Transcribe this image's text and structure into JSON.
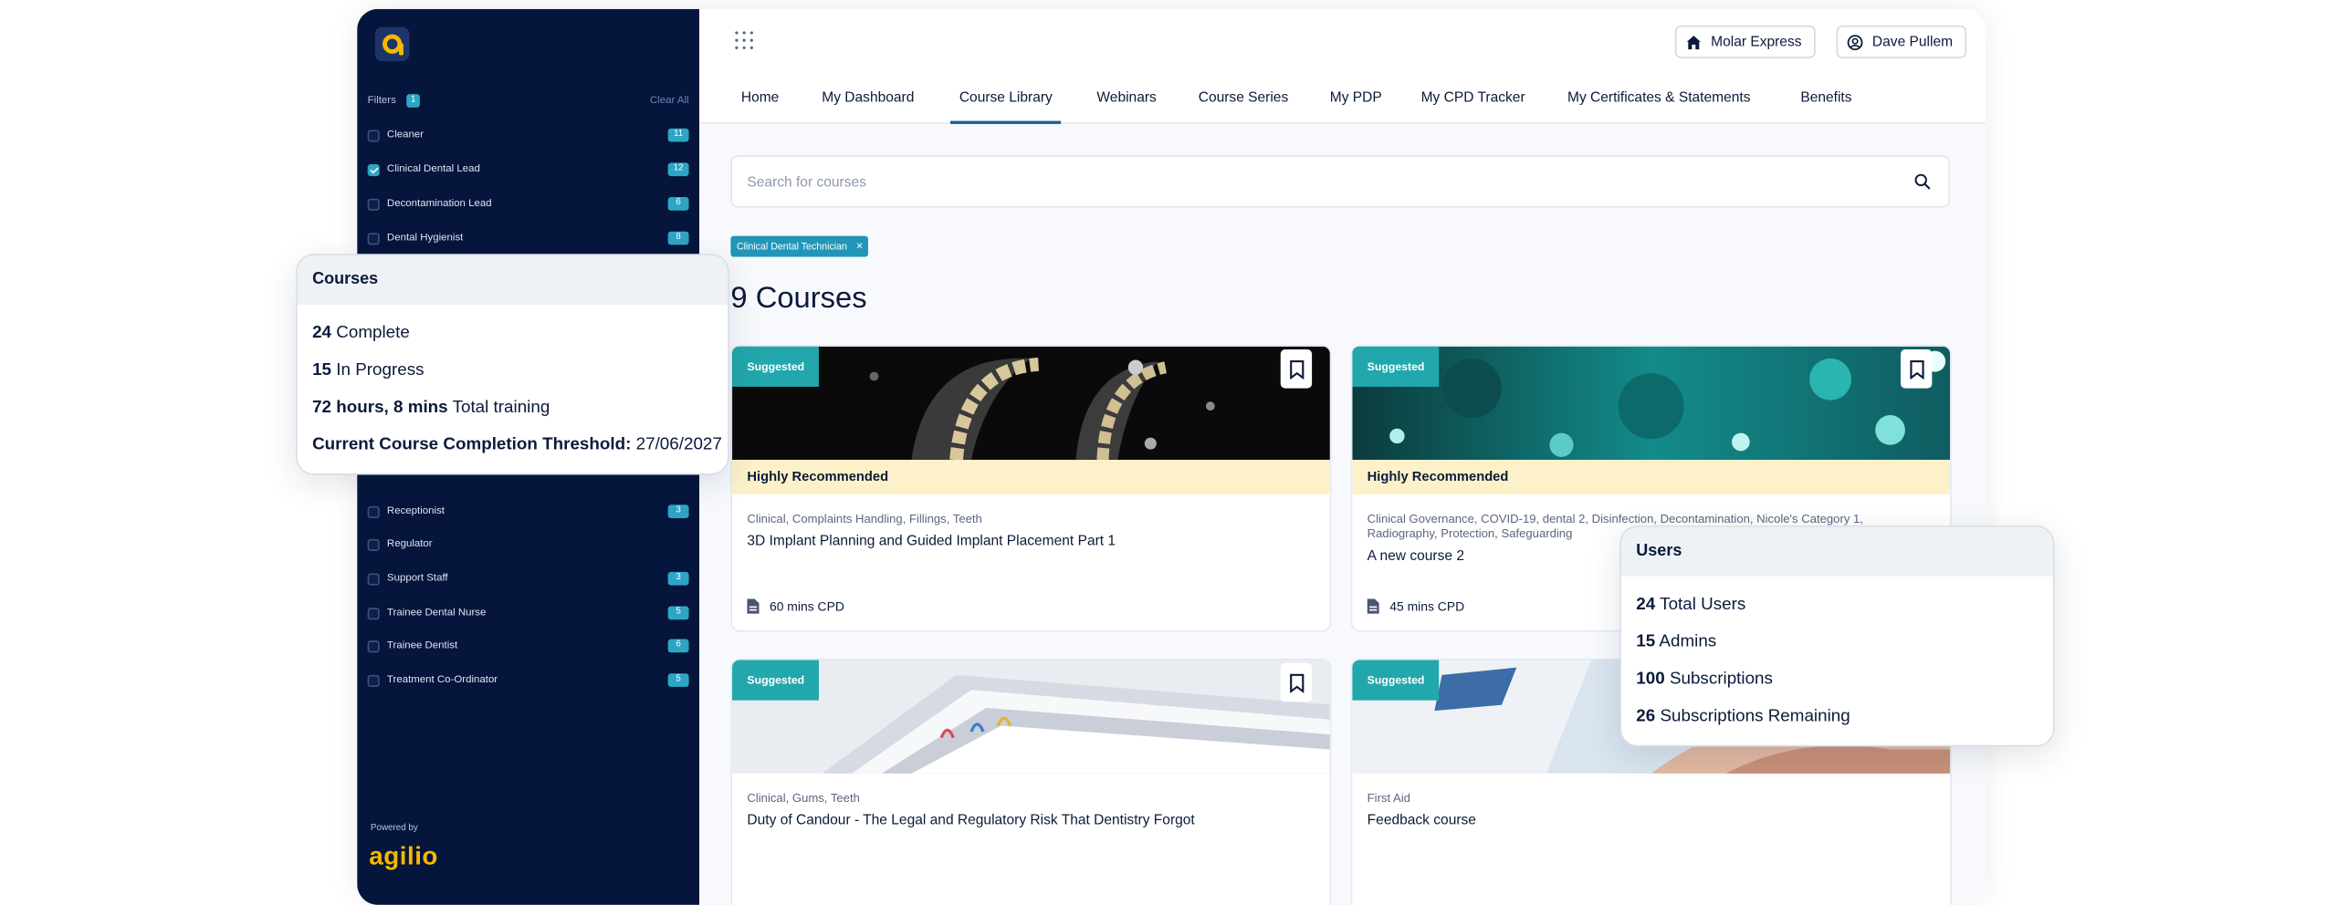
{
  "sidebar": {
    "filters_label": "Filters",
    "filters_count": "1",
    "clear_all": "Clear All",
    "items": [
      {
        "name": "Cleaner",
        "count": "11",
        "checked": false
      },
      {
        "name": "Clinical Dental Lead",
        "count": "12",
        "checked": true
      },
      {
        "name": "Decontamination Lead",
        "count": "6",
        "checked": false
      },
      {
        "name": "Dental Hygienist",
        "count": "8",
        "checked": false
      },
      {
        "name": "Receptionist",
        "count": "3",
        "checked": false
      },
      {
        "name": "Regulator",
        "count": "",
        "checked": false
      },
      {
        "name": "Support Staff",
        "count": "3",
        "checked": false
      },
      {
        "name": "Trainee Dental Nurse",
        "count": "5",
        "checked": false
      },
      {
        "name": "Trainee Dentist",
        "count": "6",
        "checked": false
      },
      {
        "name": "Treatment Co-Ordinator",
        "count": "5",
        "checked": false
      }
    ],
    "powered_by": "Powered by",
    "brand": "agilio"
  },
  "header": {
    "practice_label": "Molar Express",
    "user_label": "Dave Pullem",
    "nav": [
      "Home",
      "My Dashboard",
      "Course Library",
      "Webinars",
      "Course Series",
      "My PDP",
      "My CPD Tracker",
      "My Certificates & Statements",
      "Benefits"
    ],
    "active_tab": "Course Library"
  },
  "search": {
    "placeholder": "Search for courses",
    "value": ""
  },
  "active_filter_chip": "Clinical Dental Technician",
  "courses_count_title": "9 Courses",
  "cards": [
    {
      "badge": "Suggested",
      "recommendation": "Highly Recommended",
      "tags": "Clinical, Complaints Handling, Fillings, Teeth",
      "title": "3D Implant Planning and Guided Implant Placement Part 1",
      "cpd": "60 mins CPD"
    },
    {
      "badge": "Suggested",
      "recommendation": "Highly Recommended",
      "tags": "Clinical Governance, COVID-19, dental 2, Disinfection, Decontamination, Nicole's Category 1, Radiography, Protection, Safeguarding",
      "title": "A new course 2",
      "cpd": "45 mins CPD"
    },
    {
      "badge": "Suggested",
      "recommendation": "",
      "tags": "Clinical, Gums, Teeth",
      "title": "Duty of Candour - The Legal and Regulatory Risk That Dentistry Forgot",
      "cpd": ""
    },
    {
      "badge": "Suggested",
      "recommendation": "",
      "tags": "First Aid",
      "title": "Feedback course",
      "cpd": ""
    }
  ],
  "courses_panel": {
    "title": "Courses",
    "complete_value": "24",
    "complete_label": "Complete",
    "in_progress_value": "15",
    "in_progress_label": "In Progress",
    "training_value": "72 hours, 8 mins",
    "training_label": "Total training",
    "threshold_label": "Current Course Completion Threshold:",
    "threshold_value": "27/06/2027"
  },
  "users_panel": {
    "title": "Users",
    "total_value": "24",
    "total_label": "Total Users",
    "admins_value": "15",
    "admins_label": "Admins",
    "subs_value": "100",
    "subs_label": "Subscriptions",
    "remaining_value": "26",
    "remaining_label": "Subscriptions Remaining"
  },
  "colors": {
    "sidebar_bg": "#05153c",
    "accent_teal": "#22a7ad",
    "badge_blue": "#2ea5c5",
    "brand_yellow": "#f5b800",
    "recommend_bg": "#fdf1c9"
  }
}
